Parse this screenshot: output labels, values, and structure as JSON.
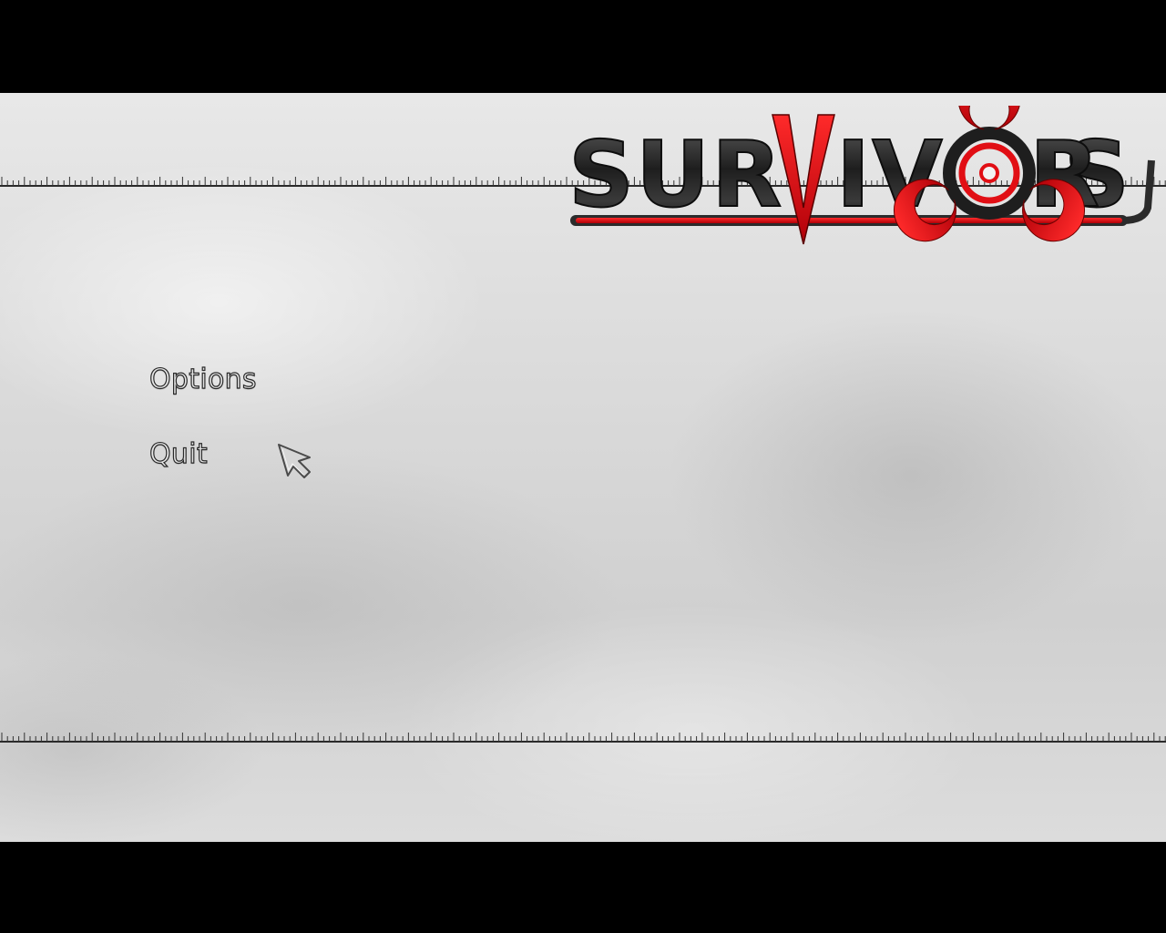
{
  "game": {
    "logo_text": "SURVIVORS",
    "accent_color": "#e10e14",
    "logo_metal_color": "#2b2b2b"
  },
  "menu": {
    "items": [
      {
        "label": "Options"
      },
      {
        "label": "Quit"
      }
    ]
  },
  "cursor": {
    "icon": "arrow-pointer-icon"
  }
}
